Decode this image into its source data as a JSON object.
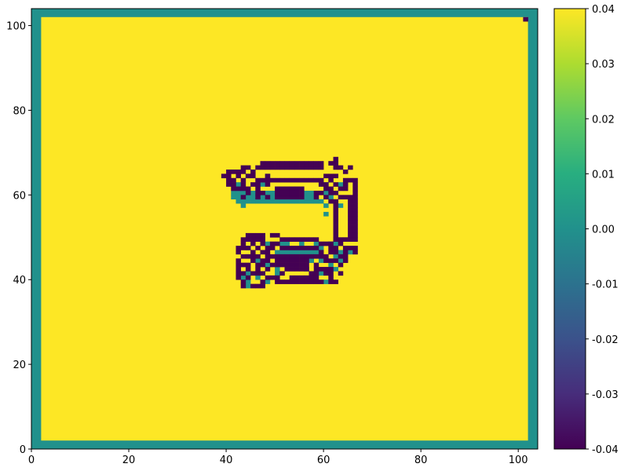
{
  "chart_data": {
    "type": "heatmap",
    "title": "",
    "xlabel": "",
    "ylabel": "",
    "xlim": [
      0,
      104
    ],
    "ylim": [
      0,
      104
    ],
    "x_ticks": [
      0,
      20,
      40,
      60,
      80,
      100
    ],
    "y_ticks": [
      0,
      20,
      40,
      60,
      80,
      100
    ],
    "colormap": "viridis",
    "color_range": [
      -0.04,
      0.04
    ],
    "colorbar_ticks": [
      "-0.04",
      "-0.03",
      "-0.02",
      "-0.01",
      "0.00",
      "0.01",
      "0.02",
      "0.03",
      "0.04"
    ],
    "background_value": 0.04,
    "border_value": 0.0,
    "border_width_cells": 2,
    "colors": {
      "high": "#fde725",
      "zero": "#21918c",
      "low": "#440154"
    },
    "cells_low": [
      [
        101,
        101
      ],
      [
        62,
        68
      ],
      [
        47,
        67
      ],
      [
        48,
        67
      ],
      [
        49,
        67
      ],
      [
        50,
        67
      ],
      [
        51,
        67
      ],
      [
        52,
        67
      ],
      [
        53,
        67
      ],
      [
        54,
        67
      ],
      [
        55,
        67
      ],
      [
        56,
        67
      ],
      [
        57,
        67
      ],
      [
        58,
        67
      ],
      [
        59,
        67
      ],
      [
        61,
        67
      ],
      [
        62,
        67
      ],
      [
        43,
        66
      ],
      [
        44,
        66
      ],
      [
        46,
        66
      ],
      [
        47,
        66
      ],
      [
        48,
        66
      ],
      [
        49,
        66
      ],
      [
        50,
        66
      ],
      [
        51,
        66
      ],
      [
        52,
        66
      ],
      [
        53,
        66
      ],
      [
        54,
        66
      ],
      [
        55,
        66
      ],
      [
        56,
        66
      ],
      [
        57,
        66
      ],
      [
        58,
        66
      ],
      [
        59,
        66
      ],
      [
        62,
        66
      ],
      [
        63,
        66
      ],
      [
        65,
        66
      ],
      [
        40,
        65
      ],
      [
        41,
        65
      ],
      [
        42,
        65
      ],
      [
        43,
        65
      ],
      [
        45,
        65
      ],
      [
        64,
        65
      ],
      [
        39,
        64
      ],
      [
        40,
        64
      ],
      [
        42,
        64
      ],
      [
        44,
        64
      ],
      [
        45,
        64
      ],
      [
        48,
        64
      ],
      [
        60,
        64
      ],
      [
        61,
        64
      ],
      [
        62,
        64
      ],
      [
        40,
        63
      ],
      [
        41,
        63
      ],
      [
        43,
        63
      ],
      [
        46,
        63
      ],
      [
        47,
        63
      ],
      [
        48,
        63
      ],
      [
        49,
        63
      ],
      [
        50,
        63
      ],
      [
        51,
        63
      ],
      [
        52,
        63
      ],
      [
        53,
        63
      ],
      [
        54,
        63
      ],
      [
        55,
        63
      ],
      [
        56,
        63
      ],
      [
        57,
        63
      ],
      [
        58,
        63
      ],
      [
        59,
        63
      ],
      [
        61,
        63
      ],
      [
        64,
        63
      ],
      [
        65,
        63
      ],
      [
        66,
        63
      ],
      [
        40,
        62
      ],
      [
        41,
        62
      ],
      [
        43,
        62
      ],
      [
        45,
        62
      ],
      [
        46,
        62
      ],
      [
        48,
        62
      ],
      [
        59,
        62
      ],
      [
        60,
        62
      ],
      [
        62,
        62
      ],
      [
        64,
        62
      ],
      [
        66,
        62
      ],
      [
        41,
        61
      ],
      [
        42,
        61
      ],
      [
        43,
        61
      ],
      [
        44,
        61
      ],
      [
        46,
        61
      ],
      [
        50,
        61
      ],
      [
        51,
        61
      ],
      [
        52,
        61
      ],
      [
        53,
        61
      ],
      [
        54,
        61
      ],
      [
        55,
        61
      ],
      [
        60,
        61
      ],
      [
        61,
        61
      ],
      [
        63,
        61
      ],
      [
        64,
        61
      ],
      [
        66,
        61
      ],
      [
        44,
        60
      ],
      [
        46,
        60
      ],
      [
        47,
        60
      ],
      [
        50,
        60
      ],
      [
        51,
        60
      ],
      [
        52,
        60
      ],
      [
        53,
        60
      ],
      [
        54,
        60
      ],
      [
        55,
        60
      ],
      [
        58,
        60
      ],
      [
        59,
        60
      ],
      [
        61,
        60
      ],
      [
        62,
        60
      ],
      [
        66,
        60
      ],
      [
        43,
        59
      ],
      [
        46,
        59
      ],
      [
        48,
        59
      ],
      [
        50,
        59
      ],
      [
        51,
        59
      ],
      [
        52,
        59
      ],
      [
        53,
        59
      ],
      [
        54,
        59
      ],
      [
        55,
        59
      ],
      [
        58,
        59
      ],
      [
        60,
        59
      ],
      [
        63,
        59
      ],
      [
        64,
        59
      ],
      [
        65,
        59
      ],
      [
        66,
        59
      ],
      [
        61,
        58
      ],
      [
        62,
        58
      ],
      [
        65,
        58
      ],
      [
        66,
        58
      ],
      [
        62,
        57
      ],
      [
        65,
        57
      ],
      [
        66,
        57
      ],
      [
        62,
        56
      ],
      [
        65,
        56
      ],
      [
        66,
        56
      ],
      [
        62,
        55
      ],
      [
        65,
        55
      ],
      [
        66,
        55
      ],
      [
        62,
        54
      ],
      [
        65,
        54
      ],
      [
        66,
        54
      ],
      [
        62,
        53
      ],
      [
        65,
        53
      ],
      [
        66,
        53
      ],
      [
        62,
        52
      ],
      [
        65,
        52
      ],
      [
        66,
        52
      ],
      [
        62,
        51
      ],
      [
        65,
        51
      ],
      [
        66,
        51
      ],
      [
        44,
        50
      ],
      [
        45,
        50
      ],
      [
        46,
        50
      ],
      [
        47,
        50
      ],
      [
        49,
        50
      ],
      [
        50,
        50
      ],
      [
        62,
        50
      ],
      [
        65,
        50
      ],
      [
        66,
        50
      ],
      [
        43,
        49
      ],
      [
        44,
        49
      ],
      [
        45,
        49
      ],
      [
        46,
        49
      ],
      [
        47,
        49
      ],
      [
        51,
        49
      ],
      [
        52,
        49
      ],
      [
        53,
        49
      ],
      [
        54,
        49
      ],
      [
        55,
        49
      ],
      [
        56,
        49
      ],
      [
        57,
        49
      ],
      [
        58,
        49
      ],
      [
        62,
        49
      ],
      [
        63,
        49
      ],
      [
        64,
        49
      ],
      [
        65,
        49
      ],
      [
        66,
        49
      ],
      [
        43,
        48
      ],
      [
        45,
        48
      ],
      [
        47,
        48
      ],
      [
        49,
        48
      ],
      [
        50,
        48
      ],
      [
        59,
        48
      ],
      [
        60,
        48
      ],
      [
        61,
        48
      ],
      [
        63,
        48
      ],
      [
        42,
        47
      ],
      [
        43,
        47
      ],
      [
        44,
        47
      ],
      [
        46,
        47
      ],
      [
        48,
        47
      ],
      [
        49,
        47
      ],
      [
        51,
        47
      ],
      [
        52,
        47
      ],
      [
        53,
        47
      ],
      [
        54,
        47
      ],
      [
        55,
        47
      ],
      [
        56,
        47
      ],
      [
        57,
        47
      ],
      [
        58,
        47
      ],
      [
        61,
        47
      ],
      [
        62,
        47
      ],
      [
        64,
        47
      ],
      [
        65,
        47
      ],
      [
        66,
        47
      ],
      [
        42,
        46
      ],
      [
        45,
        46
      ],
      [
        47,
        46
      ],
      [
        48,
        46
      ],
      [
        59,
        46
      ],
      [
        61,
        46
      ],
      [
        62,
        46
      ],
      [
        64,
        46
      ],
      [
        66,
        46
      ],
      [
        43,
        45
      ],
      [
        44,
        45
      ],
      [
        45,
        45
      ],
      [
        46,
        45
      ],
      [
        48,
        45
      ],
      [
        49,
        45
      ],
      [
        50,
        45
      ],
      [
        51,
        45
      ],
      [
        52,
        45
      ],
      [
        53,
        45
      ],
      [
        54,
        45
      ],
      [
        55,
        45
      ],
      [
        56,
        45
      ],
      [
        57,
        45
      ],
      [
        58,
        45
      ],
      [
        59,
        45
      ],
      [
        60,
        45
      ],
      [
        63,
        45
      ],
      [
        64,
        45
      ],
      [
        42,
        44
      ],
      [
        45,
        44
      ],
      [
        47,
        44
      ],
      [
        48,
        44
      ],
      [
        50,
        44
      ],
      [
        51,
        44
      ],
      [
        52,
        44
      ],
      [
        53,
        44
      ],
      [
        54,
        44
      ],
      [
        55,
        44
      ],
      [
        56,
        44
      ],
      [
        60,
        44
      ],
      [
        61,
        44
      ],
      [
        62,
        44
      ],
      [
        64,
        44
      ],
      [
        42,
        43
      ],
      [
        43,
        43
      ],
      [
        44,
        43
      ],
      [
        46,
        43
      ],
      [
        47,
        43
      ],
      [
        49,
        43
      ],
      [
        50,
        43
      ],
      [
        51,
        43
      ],
      [
        52,
        43
      ],
      [
        53,
        43
      ],
      [
        54,
        43
      ],
      [
        55,
        43
      ],
      [
        56,
        43
      ],
      [
        58,
        43
      ],
      [
        63,
        43
      ],
      [
        42,
        42
      ],
      [
        44,
        42
      ],
      [
        46,
        42
      ],
      [
        48,
        42
      ],
      [
        52,
        42
      ],
      [
        53,
        42
      ],
      [
        54,
        42
      ],
      [
        55,
        42
      ],
      [
        56,
        42
      ],
      [
        58,
        42
      ],
      [
        59,
        42
      ],
      [
        60,
        42
      ],
      [
        61,
        42
      ],
      [
        42,
        41
      ],
      [
        43,
        41
      ],
      [
        45,
        41
      ],
      [
        46,
        41
      ],
      [
        47,
        41
      ],
      [
        51,
        41
      ],
      [
        57,
        41
      ],
      [
        58,
        41
      ],
      [
        60,
        41
      ],
      [
        61,
        41
      ],
      [
        63,
        41
      ],
      [
        42,
        40
      ],
      [
        44,
        40
      ],
      [
        48,
        40
      ],
      [
        49,
        40
      ],
      [
        50,
        40
      ],
      [
        53,
        40
      ],
      [
        54,
        40
      ],
      [
        55,
        40
      ],
      [
        56,
        40
      ],
      [
        57,
        40
      ],
      [
        58,
        40
      ],
      [
        61,
        40
      ],
      [
        43,
        39
      ],
      [
        47,
        39
      ],
      [
        50,
        39
      ],
      [
        51,
        39
      ],
      [
        52,
        39
      ],
      [
        53,
        39
      ],
      [
        54,
        39
      ],
      [
        55,
        39
      ],
      [
        56,
        39
      ],
      [
        57,
        39
      ],
      [
        58,
        39
      ],
      [
        59,
        39
      ],
      [
        61,
        39
      ],
      [
        62,
        39
      ],
      [
        43,
        38
      ],
      [
        45,
        38
      ],
      [
        46,
        38
      ],
      [
        47,
        38
      ]
    ],
    "cells_zero": [
      [
        44,
        64
      ],
      [
        48,
        64
      ],
      [
        42,
        62
      ],
      [
        47,
        62
      ],
      [
        60,
        62
      ],
      [
        63,
        62
      ],
      [
        64,
        62
      ],
      [
        41,
        60
      ],
      [
        42,
        60
      ],
      [
        43,
        60
      ],
      [
        45,
        60
      ],
      [
        48,
        60
      ],
      [
        49,
        60
      ],
      [
        56,
        60
      ],
      [
        57,
        60
      ],
      [
        60,
        60
      ],
      [
        41,
        59
      ],
      [
        42,
        59
      ],
      [
        44,
        59
      ],
      [
        45,
        59
      ],
      [
        47,
        59
      ],
      [
        49,
        59
      ],
      [
        56,
        59
      ],
      [
        57,
        59
      ],
      [
        61,
        59
      ],
      [
        42,
        58
      ],
      [
        43,
        58
      ],
      [
        44,
        58
      ],
      [
        45,
        58
      ],
      [
        46,
        58
      ],
      [
        47,
        58
      ],
      [
        48,
        58
      ],
      [
        49,
        58
      ],
      [
        50,
        58
      ],
      [
        51,
        58
      ],
      [
        52,
        58
      ],
      [
        53,
        58
      ],
      [
        54,
        58
      ],
      [
        55,
        58
      ],
      [
        56,
        58
      ],
      [
        57,
        58
      ],
      [
        58,
        58
      ],
      [
        59,
        58
      ],
      [
        43,
        57
      ],
      [
        60,
        57
      ],
      [
        63,
        57
      ],
      [
        60,
        55
      ],
      [
        44,
        49
      ],
      [
        62,
        49
      ],
      [
        48,
        48
      ],
      [
        51,
        48
      ],
      [
        52,
        48
      ],
      [
        55,
        48
      ],
      [
        58,
        48
      ],
      [
        61,
        48
      ],
      [
        62,
        48
      ],
      [
        44,
        47
      ],
      [
        58,
        47
      ],
      [
        59,
        47
      ],
      [
        50,
        46
      ],
      [
        51,
        46
      ],
      [
        52,
        46
      ],
      [
        53,
        46
      ],
      [
        54,
        46
      ],
      [
        55,
        46
      ],
      [
        56,
        46
      ],
      [
        57,
        46
      ],
      [
        58,
        46
      ],
      [
        63,
        46
      ],
      [
        65,
        46
      ],
      [
        44,
        45
      ],
      [
        58,
        45
      ],
      [
        62,
        45
      ],
      [
        46,
        44
      ],
      [
        57,
        44
      ],
      [
        59,
        44
      ],
      [
        63,
        44
      ],
      [
        48,
        43
      ],
      [
        61,
        43
      ],
      [
        50,
        42
      ],
      [
        56,
        42
      ],
      [
        62,
        42
      ],
      [
        44,
        41
      ],
      [
        50,
        41
      ],
      [
        59,
        41
      ],
      [
        43,
        40
      ],
      [
        46,
        40
      ],
      [
        44,
        39
      ],
      [
        48,
        39
      ],
      [
        60,
        39
      ],
      [
        44,
        38
      ]
    ]
  }
}
